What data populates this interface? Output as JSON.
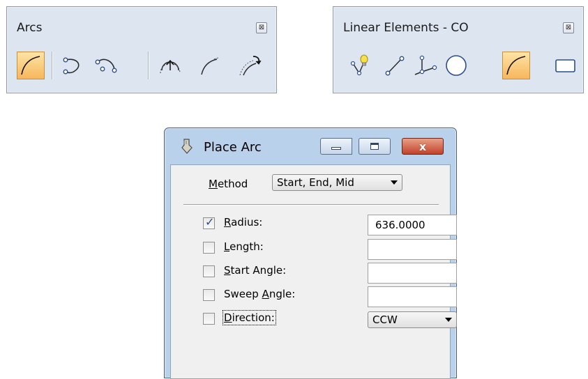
{
  "arcs_toolbar": {
    "title": "Arcs",
    "close_glyph": "⊠",
    "tools": [
      {
        "icon": "place-arc-icon",
        "active": true
      },
      {
        "icon": "place-half-ellipse-icon",
        "active": false
      },
      {
        "icon": "place-quarter-ellipse-icon",
        "active": false
      },
      {
        "icon": "modify-arc-radius-icon",
        "active": false
      },
      {
        "icon": "modify-arc-angle-icon",
        "active": false
      },
      {
        "icon": "modify-arc-axis-icon",
        "active": false
      }
    ]
  },
  "linear_toolbar": {
    "title": "Linear Elements - CO",
    "close_glyph": "⊠",
    "tools": [
      {
        "icon": "smartline-icon",
        "active": false
      },
      {
        "icon": "place-line-icon",
        "active": false
      },
      {
        "icon": "place-multiline-icon",
        "active": false
      },
      {
        "icon": "place-circle-icon",
        "active": false
      },
      {
        "icon": "place-arc-icon",
        "active": true
      },
      {
        "icon": "place-block-icon",
        "active": false
      }
    ]
  },
  "dialog": {
    "title": "Place Arc",
    "close_glyph": "x",
    "method": {
      "label_underlined": "M",
      "label_rest": "ethod",
      "value": "Start, End, Mid"
    },
    "options": [
      {
        "checked": true,
        "label_pre": "",
        "label_u": "R",
        "label_post": "adius:",
        "control": "text",
        "value": "636.0000"
      },
      {
        "checked": false,
        "label_pre": "",
        "label_u": "L",
        "label_post": "ength:",
        "control": "text",
        "value": ""
      },
      {
        "checked": false,
        "label_pre": "",
        "label_u": "S",
        "label_post": "tart Angle:",
        "control": "text",
        "value": ""
      },
      {
        "checked": false,
        "label_pre": "Sweep ",
        "label_u": "A",
        "label_post": "ngle:",
        "control": "text",
        "value": ""
      },
      {
        "checked": false,
        "label_pre": "",
        "label_u": "D",
        "label_post": "irection:",
        "control": "dropdown",
        "value": "CCW"
      }
    ]
  },
  "colors": {
    "toolbar_bg": "#dde5f1",
    "active_tool": "#f7b65c",
    "dialog_frame": "#b9d1ea",
    "close_button": "#c2412a"
  }
}
